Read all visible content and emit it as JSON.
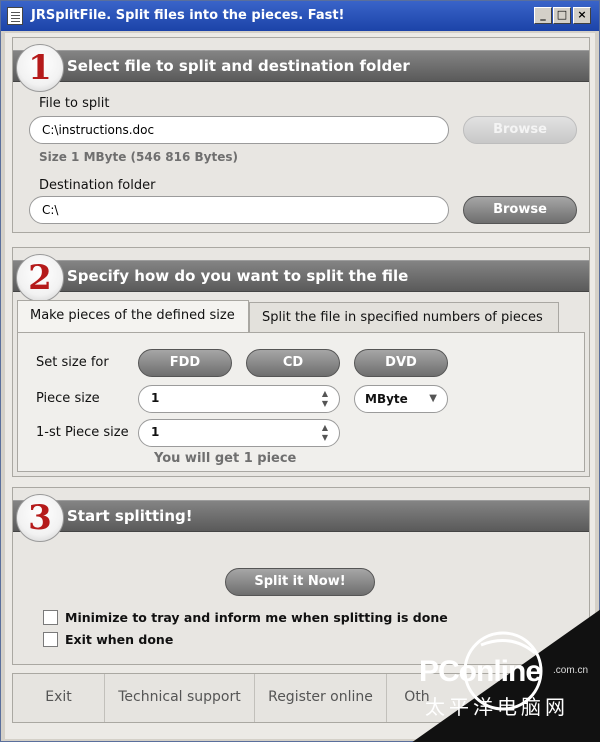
{
  "window": {
    "title": "JRSplitFile. Split files into the pieces. Fast!",
    "buttons": [
      "_",
      "□",
      "×"
    ]
  },
  "section1": {
    "number": "1",
    "title": "Select file to split and destination folder",
    "file_label": "File to split",
    "file_value": "C:\\instructions.doc",
    "browse_file_label": "Browse",
    "size_text": "Size 1 MByte (546 816 Bytes)",
    "dest_label": "Destination folder",
    "dest_value": "C:\\",
    "browse_dest_label": "Browse"
  },
  "section2": {
    "number": "2",
    "title": "Specify how do you want to split the file",
    "tabs": [
      {
        "label": "Make pieces of the defined size",
        "active": true
      },
      {
        "label": "Split the file in specified numbers of pieces",
        "active": false
      }
    ],
    "set_size_label": "Set size for",
    "size_presets": [
      "FDD",
      "CD",
      "DVD"
    ],
    "piece_size_label": "Piece size",
    "piece_size_value": "1",
    "unit_value": "MByte",
    "first_piece_label": "1-st Piece size",
    "first_piece_value": "1",
    "result_text": "You will get 1 piece"
  },
  "section3": {
    "number": "3",
    "title": "Start splitting!",
    "split_button": "Split it Now!",
    "options": [
      {
        "label": "Minimize to tray and inform me when splitting is done",
        "checked": false
      },
      {
        "label": "Exit when done",
        "checked": false
      }
    ]
  },
  "footer": {
    "buttons": [
      "Exit",
      "Technical support",
      "Register online",
      "Oth"
    ]
  },
  "watermark": {
    "brand": "PConline",
    "domain": ".com.cn",
    "chinese": "太平洋电脑网"
  },
  "colors": {
    "titlebar": "#2a52b8",
    "section_header": "#6b6b6b",
    "number": "#b51a1a"
  }
}
